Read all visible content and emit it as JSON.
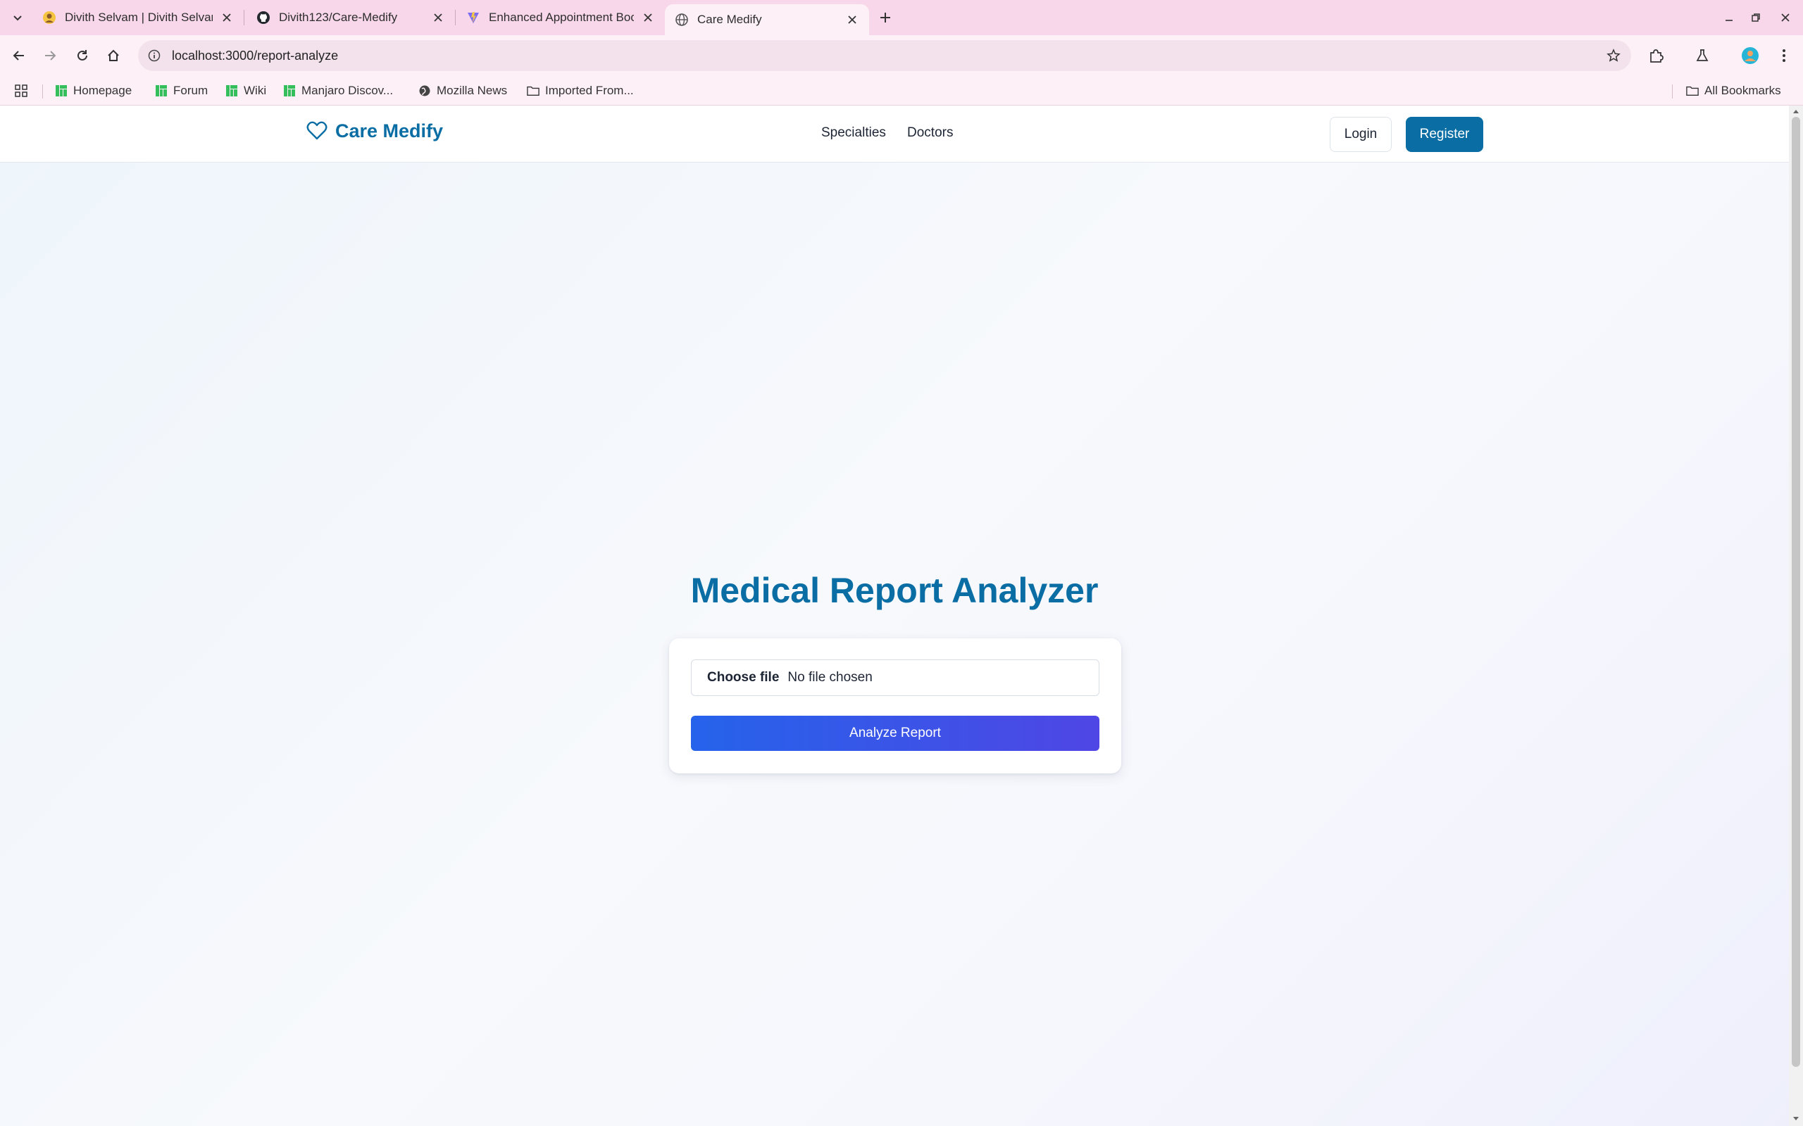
{
  "browser": {
    "tabs": [
      {
        "title": "Divith Selvam | Divith Selvam",
        "favicon": "avatar-favicon-icon"
      },
      {
        "title": "Divith123/Care-Medify",
        "favicon": "github-icon"
      },
      {
        "title": "Enhanced Appointment Booking",
        "favicon": "vite-icon"
      },
      {
        "title": "Care Medify",
        "favicon": "globe-icon"
      }
    ],
    "url": "localhost:3000/report-analyze",
    "bookmarks": [
      "Homepage",
      "Forum",
      "Wiki",
      "Manjaro Discov...",
      "Mozilla News",
      "Imported From..."
    ],
    "all_bookmarks": "All Bookmarks"
  },
  "site": {
    "brand": "Care Medify",
    "nav": {
      "specialties": "Specialties",
      "doctors": "Doctors"
    },
    "login": "Login",
    "register": "Register"
  },
  "main": {
    "title": "Medical Report Analyzer",
    "file_button": "Choose file",
    "file_status": "No file chosen",
    "analyze_button": "Analyze Report"
  },
  "colors": {
    "brand": "#0a6ea4",
    "button_gradient_start": "#2563eb",
    "button_gradient_end": "#4f46e5",
    "tab_strip": "#f8d7ea"
  }
}
